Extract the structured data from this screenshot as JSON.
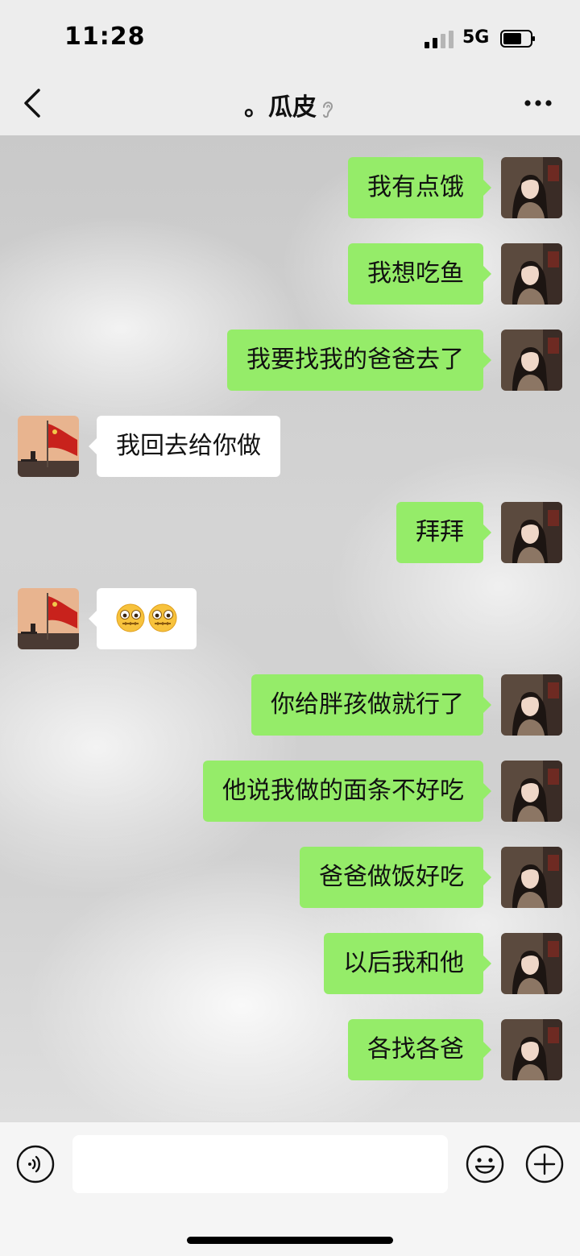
{
  "status_bar": {
    "time": "11:28",
    "network": "5G"
  },
  "header": {
    "title": "。瓜皮",
    "back_icon": "chevron-left-icon",
    "more_icon": "more-dots-icon",
    "ear_icon": "ear-icon"
  },
  "messages": [
    {
      "side": "right",
      "text": "我有点饿"
    },
    {
      "side": "right",
      "text": "我想吃鱼"
    },
    {
      "side": "right",
      "text": "我要找我的爸爸去了"
    },
    {
      "side": "left",
      "text": "我回去给你做"
    },
    {
      "side": "right",
      "text": "拜拜"
    },
    {
      "side": "left",
      "emoji": "zipper-mouth-face-emoji x2"
    },
    {
      "side": "right",
      "text": "你给胖孩做就行了"
    },
    {
      "side": "right",
      "text": "他说我做的面条不好吃"
    },
    {
      "side": "right",
      "text": "爸爸做饭好吃"
    },
    {
      "side": "right",
      "text": "以后我和他"
    },
    {
      "side": "right",
      "text": "各找各爸"
    }
  ],
  "input_bar": {
    "value": "",
    "voice_icon": "voice-icon",
    "emoji_icon": "smiley-icon",
    "plus_icon": "plus-icon"
  },
  "colors": {
    "sent_bubble": "#95ec69",
    "received_bubble": "#ffffff",
    "bar_background": "#ededed"
  }
}
